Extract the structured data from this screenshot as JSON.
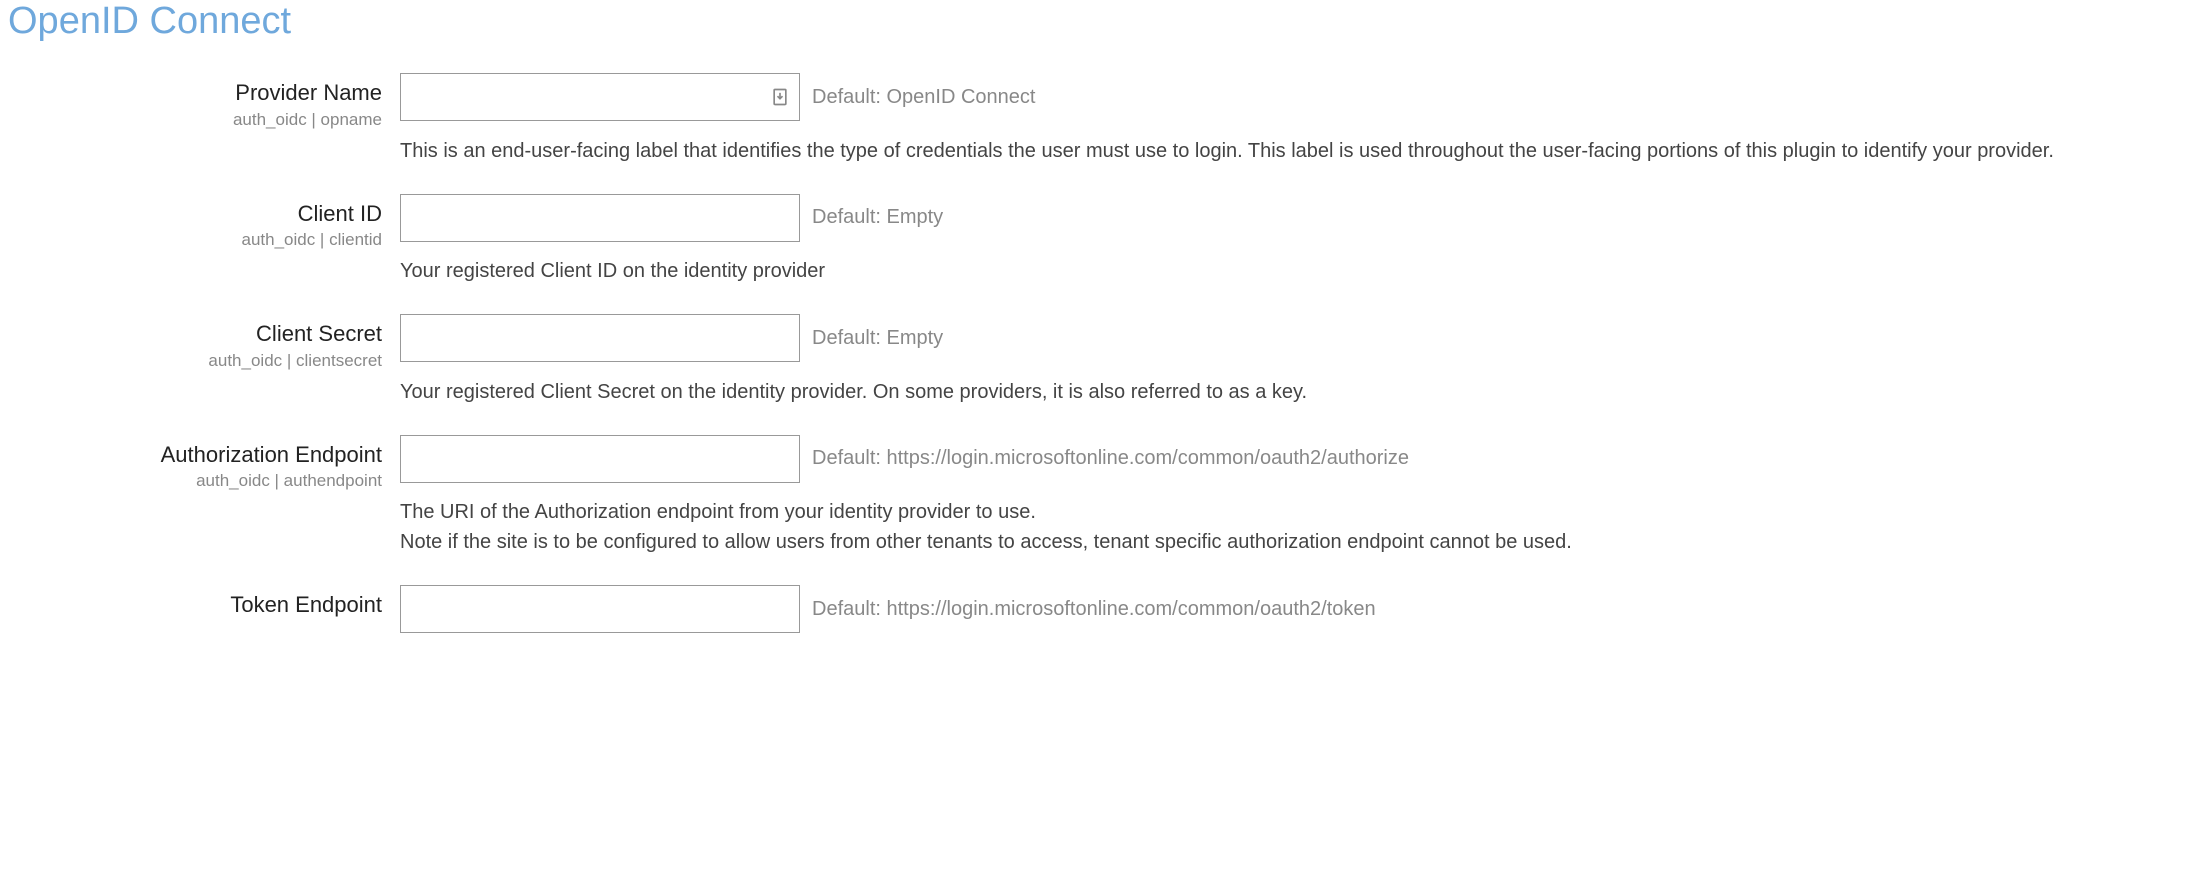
{
  "page": {
    "title": "OpenID Connect"
  },
  "settings": [
    {
      "label": "Provider Name",
      "key": "auth_oidc | opname",
      "value": "",
      "default": "Default: OpenID Connect",
      "show_autofill_icon": true,
      "description": "This is an end-user-facing label that identifies the type of credentials the user must use to login. This label is used throughout the user-facing portions of this plugin to identify your provider."
    },
    {
      "label": "Client ID",
      "key": "auth_oidc | clientid",
      "value": "",
      "default": "Default: Empty",
      "show_autofill_icon": false,
      "description": "Your registered Client ID on the identity provider"
    },
    {
      "label": "Client Secret",
      "key": "auth_oidc | clientsecret",
      "value": "",
      "default": "Default: Empty",
      "show_autofill_icon": false,
      "description": "Your registered Client Secret on the identity provider. On some providers, it is also referred to as a key."
    },
    {
      "label": "Authorization Endpoint",
      "key": "auth_oidc | authendpoint",
      "value": "",
      "default": "Default: https://login.microsoftonline.com/common/oauth2/authorize",
      "show_autofill_icon": false,
      "description": "The URI of the Authorization endpoint from your identity provider to use.\nNote if the site is to be configured to allow users from other tenants to access, tenant specific authorization endpoint cannot be used."
    },
    {
      "label": "Token Endpoint",
      "key": "",
      "value": "",
      "default": "Default: https://login.microsoftonline.com/common/oauth2/token",
      "show_autofill_icon": false,
      "description": ""
    }
  ]
}
